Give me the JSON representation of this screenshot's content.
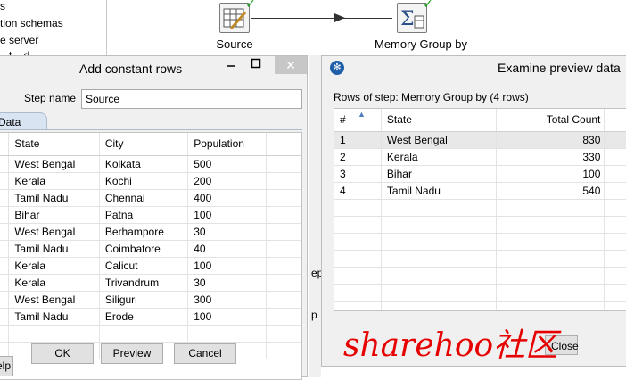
{
  "tree": [
    "s",
    "tion schemas",
    "e server",
    "...t ...d"
  ],
  "canvas": {
    "steps": [
      {
        "label": "Source",
        "icon": "table-input-icon"
      },
      {
        "label": "Memory Group by",
        "icon": "sigma-group-icon"
      }
    ],
    "gap_texts": [
      "ep",
      "p"
    ]
  },
  "left_dialog": {
    "title": "Add constant rows",
    "minimize": "🗕",
    "maximize": "□",
    "close": "✕",
    "step_name_label": "Step name",
    "step_name_value": "Source",
    "tab": "Data",
    "columns": [
      "State",
      "City",
      "Population"
    ],
    "rows": [
      [
        "West Bengal",
        "Kolkata",
        "500"
      ],
      [
        "Kerala",
        "Kochi",
        "200"
      ],
      [
        "Tamil Nadu",
        "Chennai",
        "400"
      ],
      [
        "Bihar",
        "Patna",
        "100"
      ],
      [
        "West Bengal",
        "Berhampore",
        "30"
      ],
      [
        "Tamil Nadu",
        "Coimbatore",
        "40"
      ],
      [
        "Kerala",
        "Calicut",
        "100"
      ],
      [
        "Kerala",
        "Trivandrum",
        "30"
      ],
      [
        "West Bengal",
        "Siliguri",
        "300"
      ],
      [
        "Tamil Nadu",
        "Erode",
        "100"
      ]
    ],
    "buttons": {
      "ok": "OK",
      "preview": "Preview",
      "cancel": "Cancel",
      "help": "elp"
    }
  },
  "right_dialog": {
    "title": "Examine preview data",
    "rows_caption": "Rows of step: Memory Group by (4 rows)",
    "columns": [
      "#",
      "State",
      "Total Count"
    ],
    "rows": [
      [
        "1",
        "West Bengal",
        "830"
      ],
      [
        "2",
        "Kerala",
        "330"
      ],
      [
        "3",
        "Bihar",
        "100"
      ],
      [
        "4",
        "Tamil Nadu",
        "540"
      ]
    ],
    "close_button": "Close"
  },
  "watermark": "sharehoo社区"
}
